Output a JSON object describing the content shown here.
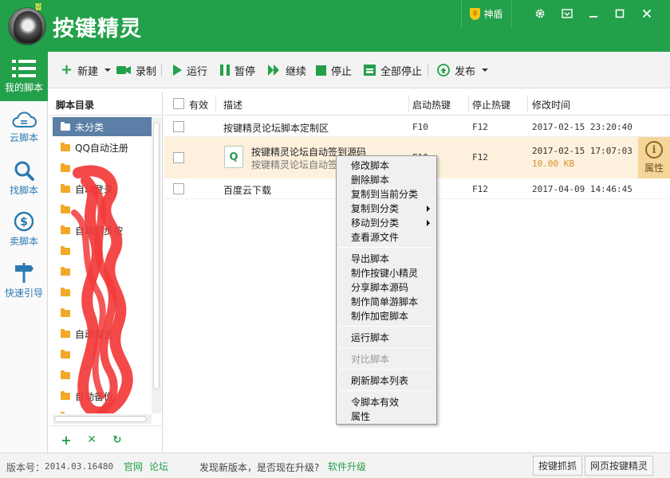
{
  "app": {
    "title": "按键精灵",
    "shield_label": "神盾",
    "colors": {
      "brand_green": "#23a04a",
      "selection": "#5b7fa6",
      "row_highlight": "#fdf0dc",
      "info_bg": "#f6d59a"
    },
    "window_icons": [
      "gear-icon",
      "menu-icon",
      "minimize-icon",
      "maximize-icon",
      "close-icon"
    ]
  },
  "nav": {
    "items": [
      {
        "label": "我的脚本",
        "icon": "list-icon"
      },
      {
        "label": "云脚本",
        "icon": "cloud-icon"
      },
      {
        "label": "找脚本",
        "icon": "search-icon"
      },
      {
        "label": "卖脚本",
        "icon": "dollar-icon"
      },
      {
        "label": "快速引导",
        "icon": "signpost-icon"
      }
    ]
  },
  "toolbar": {
    "new": "新建",
    "record": "录制",
    "run": "运行",
    "pause": "暂停",
    "resume": "继续",
    "stop": "停止",
    "stop_all": "全部停止",
    "publish": "发布"
  },
  "tree": {
    "title": "脚本目录",
    "items": [
      "未分类",
      "QQ自动注册",
      "",
      "自动登录",
      "",
      "自动同步按",
      "",
      "",
      "",
      "",
      "自动发言",
      "",
      "",
      "自动备份",
      ""
    ]
  },
  "table": {
    "headers": {
      "valid": "有效",
      "desc": "描述",
      "start_key": "启动热键",
      "stop_key": "停止热键",
      "modified": "修改时间"
    },
    "rows": [
      {
        "desc": "按键精灵论坛脚本定制区",
        "start_key": "F10",
        "stop_key": "F12",
        "modified": "2017-02-15 23:20:40"
      },
      {
        "desc": "按键精灵论坛自动签到源码",
        "desc2": "按键精灵论坛自动签",
        "start_key": "F10",
        "stop_key": "F12",
        "modified": "2017-02-15 17:07:03",
        "size": "10.00 KB",
        "file_icon": "Q",
        "info_label": "属性"
      },
      {
        "desc": "百度云下载",
        "start_key": "",
        "stop_key": "F12",
        "modified": "2017-04-09 14:46:45"
      }
    ]
  },
  "context_menu": {
    "group1": [
      "修改脚本",
      "删除脚本",
      "复制到当前分类",
      "复制到分类",
      "移动到分类",
      "查看源文件"
    ],
    "group2": [
      "导出脚本",
      "制作按键小精灵",
      "分享脚本源码",
      "制作简单游脚本",
      "制作加密脚本"
    ],
    "run": "运行脚本",
    "compare": "对比脚本",
    "refresh": "刷新脚本列表",
    "make_valid": "令脚本有效",
    "properties": "属性"
  },
  "status": {
    "version_label": "版本号：",
    "version": "2014.03.16480",
    "official_site": "官网",
    "forum": "论坛",
    "update_prompt": "发现新版本，是否现在升级?",
    "upgrade": "软件升级",
    "btn_capture": "按键抓抓",
    "btn_web": "网页按键精灵"
  }
}
